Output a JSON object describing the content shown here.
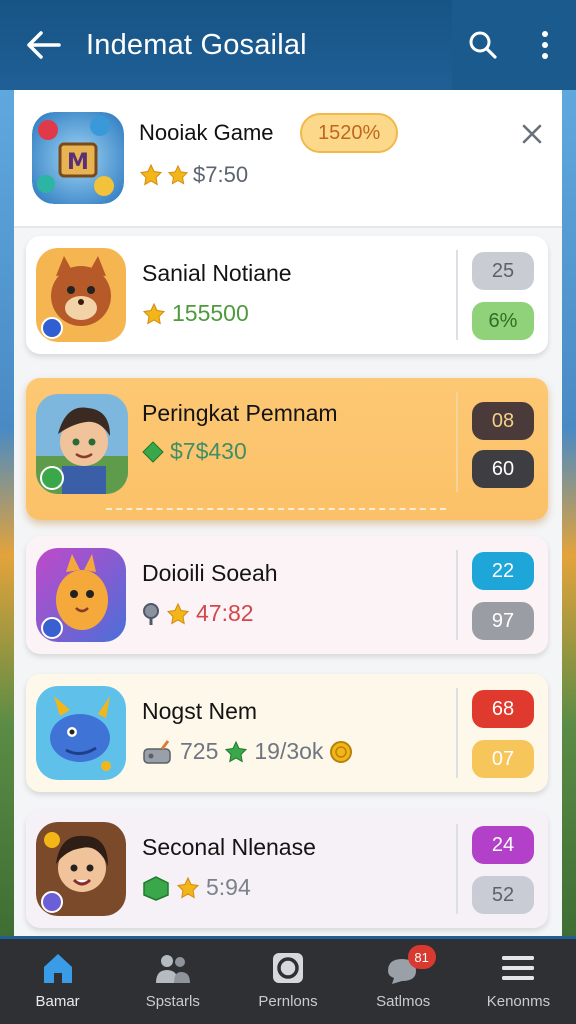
{
  "header": {
    "title": "Indemat Gosailal",
    "back_icon": "arrow-left-icon",
    "search_icon": "search-icon",
    "more_icon": "more-vertical-icon"
  },
  "featured": {
    "name": "Nooiak Game",
    "pill": "1520%",
    "meta": "$7:50"
  },
  "items": [
    {
      "name": "Sanial Notiane",
      "meta": "155500",
      "meta_color": "#4e9a3c",
      "badge1": "25",
      "badge1_color": "#c9cdd3",
      "badge2": "6%",
      "badge2_color": "#8fd27a"
    },
    {
      "name": "Peringkat Pemnam",
      "meta": "$7$430",
      "meta_color": "#3f8f66",
      "badge1": "08",
      "badge1_color": "#4a3a3a",
      "badge2": "60",
      "badge2_color": "#3d3d42"
    },
    {
      "name": "Doioili Soeah",
      "meta": "47:82",
      "meta_color": "#d2484a",
      "badge1": "22",
      "badge1_color": "#1ea6d9",
      "badge2": "97",
      "badge2_color": "#9a9ea4"
    },
    {
      "name": "Nogst Nem",
      "meta_a": "725",
      "meta_b": "19/3ok",
      "meta_color": "#6f7680",
      "badge1": "68",
      "badge1_color": "#e0392d",
      "badge2": "07",
      "badge2_color": "#f7c65a"
    },
    {
      "name": "Seconal Nlenase",
      "meta": "5:94",
      "meta_color": "#7a828c",
      "badge1": "24",
      "badge1_color": "#b340c8",
      "badge2": "52",
      "badge2_color": "#c9ccd4"
    }
  ],
  "nav": [
    {
      "label": "Bamar",
      "icon": "home-icon",
      "active": true
    },
    {
      "label": "Spstarls",
      "icon": "people-icon",
      "active": false
    },
    {
      "label": "Pernlons",
      "icon": "circle-button-icon",
      "active": false
    },
    {
      "label": "Satlmos",
      "icon": "chat-icon",
      "active": false,
      "badge": "81"
    },
    {
      "label": "Kenonms",
      "icon": "menu-icon",
      "active": false
    }
  ]
}
